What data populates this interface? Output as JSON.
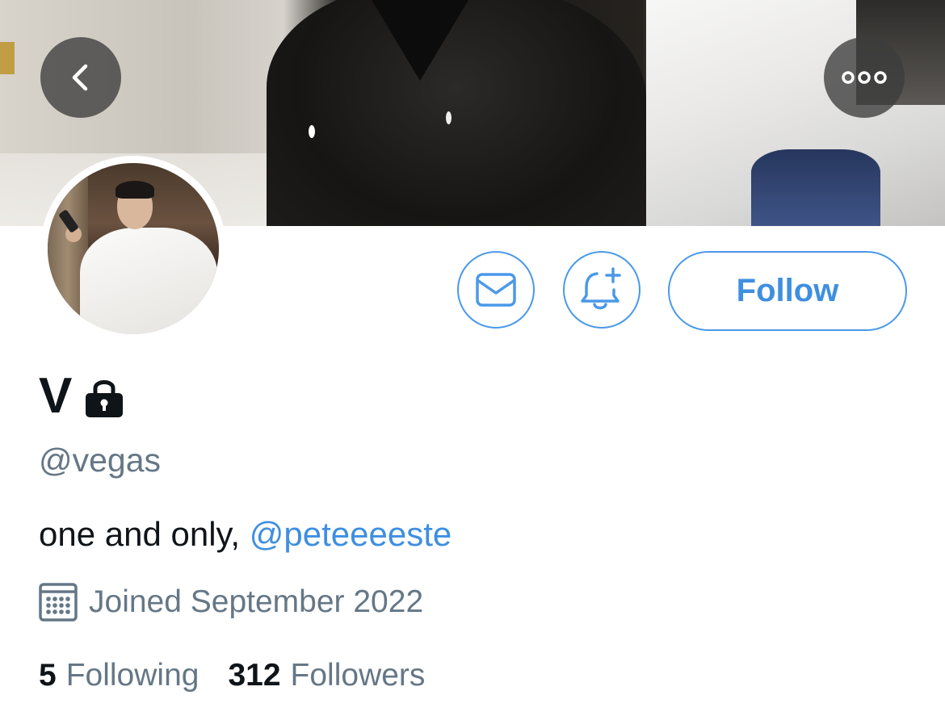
{
  "header": {
    "back_icon": "chevron-left-icon",
    "more_icon": "more-horizontal-icon"
  },
  "actions": {
    "message_icon": "envelope-icon",
    "notify_icon": "bell-plus-icon",
    "follow_label": "Follow"
  },
  "profile": {
    "name": "V",
    "protected_icon": "lock-icon",
    "handle": "@vegas",
    "bio_text": "one and only, ",
    "bio_mention": "@peteeeeste",
    "joined_icon": "calendar-icon",
    "joined": "Joined September 2022",
    "following_count": "5",
    "following_label": "Following",
    "followers_count": "312",
    "followers_label": "Followers"
  },
  "colors": {
    "accent": "#4a99e9",
    "text": "#0f1419",
    "secondary": "#657786"
  }
}
